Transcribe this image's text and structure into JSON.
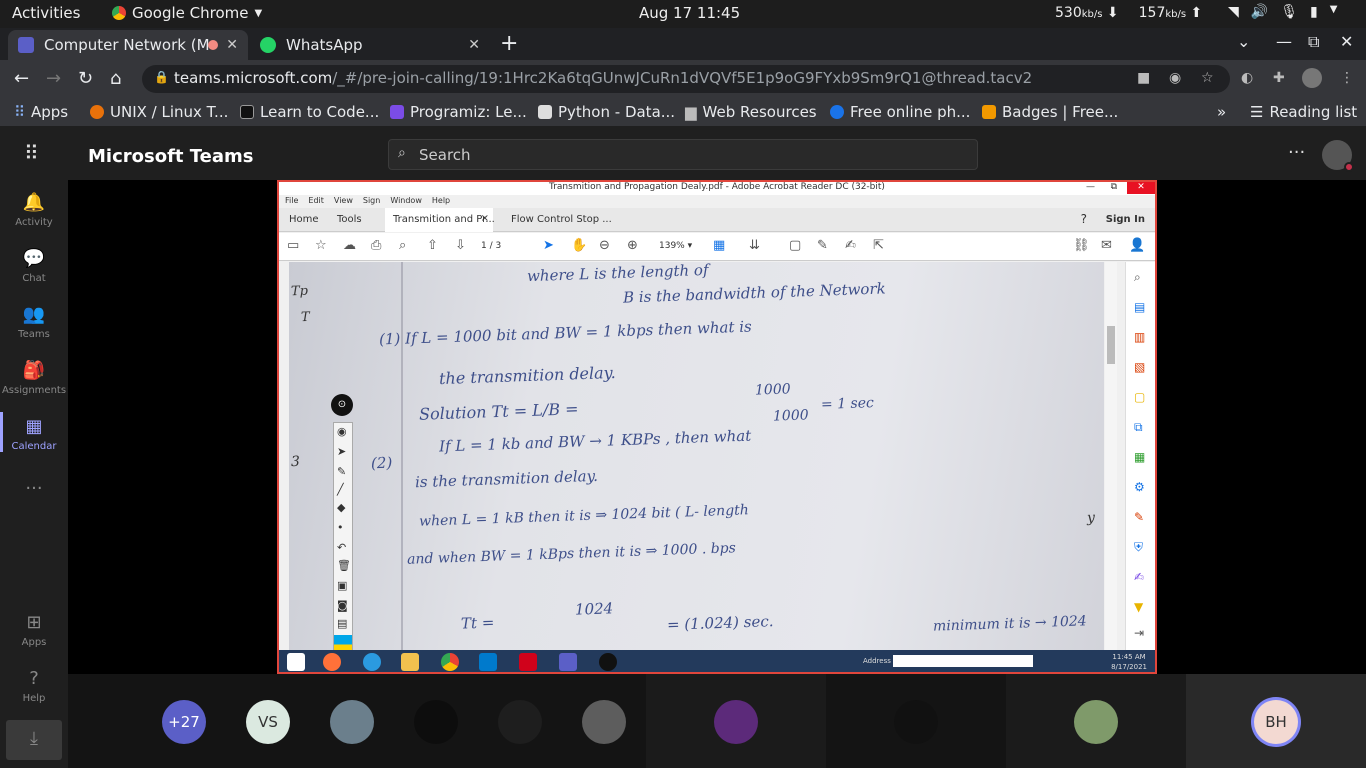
{
  "gnome": {
    "activities": "Activities",
    "app_name": "Google Chrome",
    "datetime": "Aug 17  11:45",
    "down_rate": "530",
    "down_unit": "kb/s",
    "up_rate": "157",
    "up_unit": "kb/s"
  },
  "tabs": [
    {
      "title": "Computer Network (M",
      "close": "✕"
    },
    {
      "title": "WhatsApp",
      "close": "✕"
    }
  ],
  "url": {
    "host": "teams.microsoft.com",
    "path": "/_#/pre-join-calling/19:1Hrc2Ka6tqGUnwJCuRn1dVQVf5E1p9oG9FYxb9Sm9rQ1@thread.tacv2"
  },
  "bookmarks": {
    "apps": "Apps",
    "items": [
      "UNIX / Linux T...",
      "Learn to Code...",
      "Programiz: Le...",
      "Python - Data...",
      "Web Resources",
      "Free online ph...",
      "Badges | Free..."
    ],
    "more": "»",
    "reading_list": "Reading list"
  },
  "teams": {
    "title": "Microsoft Teams",
    "search_placeholder": "Search",
    "more": "···",
    "rail": [
      "Activity",
      "Chat",
      "Teams",
      "Assignments",
      "Calendar",
      "Apps",
      "Help"
    ],
    "rail_more": "···"
  },
  "acrobat": {
    "window_title": "Transmition and Propagation Dealy.pdf - Adobe Acrobat Reader DC (32-bit)",
    "menu": [
      "File",
      "Edit",
      "View",
      "Sign",
      "Window",
      "Help"
    ],
    "tabs": [
      "Home",
      "Tools",
      "Transmition and Pr...",
      "Flow Control Stop ..."
    ],
    "tab_close": "×",
    "sign_in": "Sign In",
    "page_current": "1",
    "page_total": "/ 3",
    "zoom": "139%"
  },
  "handwriting": [
    "where   L  is the  length of",
    "B  is the  bandwidth  of the Network",
    "(1)  If   L  =  1000 bit       and   BW = 1 kbps  then   what is",
    "the  transmition  delay.",
    "Solution    Tt  =  L/B  =",
    "1000",
    "1000",
    "=  1  sec",
    "If   L  =  1 kb       and  BW  →  1 KBPs ,  then  what",
    "(2)",
    "is the  transmition  delay.",
    "when   L  =  1 kB  then    it    is  ⇒  1024 bit ( L- length",
    "and  when    BW = 1 kBps   then    it  is  ⇒   1000 . bps",
    "Tt  =",
    "1024",
    "=  (1.024) sec.",
    "Tp",
    "T",
    "3",
    "y",
    "minimum it is → 1024"
  ],
  "win_taskbar": {
    "address_label": "Address",
    "time": "11:45 AM",
    "date": "8/17/2021"
  },
  "participants": [
    {
      "label": "+27",
      "color": "#5b5fc7",
      "text_color": "#ffffff"
    },
    {
      "label": "VS",
      "color": "#dbe9e0",
      "text_color": "#333333"
    },
    {
      "label": "",
      "color": "#6b7f8c",
      "text_color": "#ffffff"
    },
    {
      "label": "",
      "color": "#0d0d0d",
      "text_color": "#ffffff"
    },
    {
      "label": "",
      "color": "#1e1e1e",
      "text_color": "#ffffff"
    },
    {
      "label": "",
      "color": "#5d5d5d",
      "text_color": "#ffffff"
    },
    {
      "label": "",
      "color": "#5c2a7a",
      "text_color": "#ffffff"
    },
    {
      "label": "",
      "color": "#111111",
      "text_color": "#ffffff"
    },
    {
      "label": "",
      "color": "#7f9a6a",
      "text_color": "#ffffff"
    },
    {
      "label": "BH",
      "color": "#f3d9d2",
      "text_color": "#333333"
    }
  ]
}
